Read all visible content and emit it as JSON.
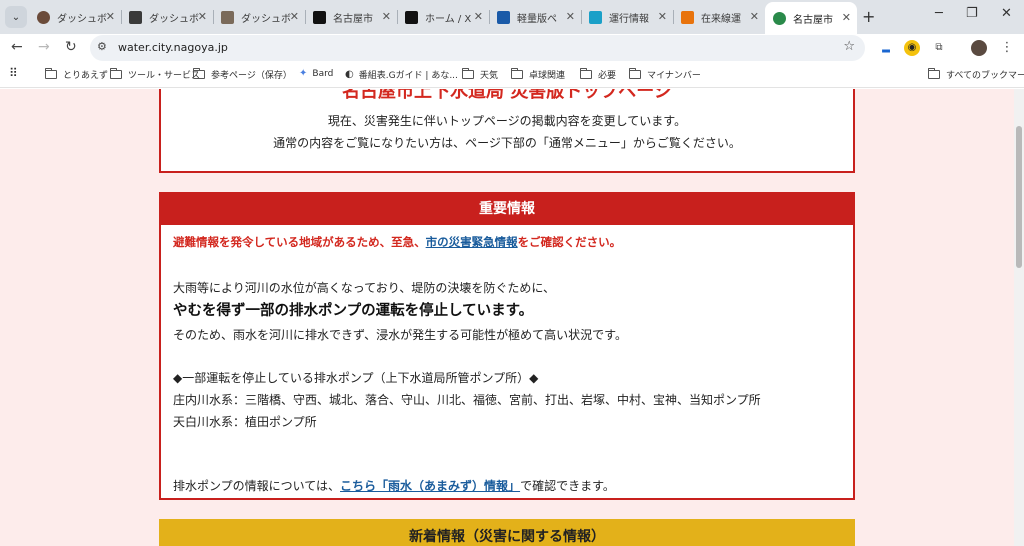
{
  "tabs": [
    {
      "label": "ダッシュボード",
      "color": "#6b4b3a"
    },
    {
      "label": "ダッシュボード",
      "color": "#3a3a3a"
    },
    {
      "label": "ダッシュボード",
      "color": "#7a6a5a"
    },
    {
      "label": "名古屋市",
      "color": "#111111"
    },
    {
      "label": "ホーム / X",
      "color": "#111111"
    },
    {
      "label": "軽量版ペ",
      "color": "#1a5aa8"
    },
    {
      "label": "運行情報",
      "color": "#1aa0c8"
    },
    {
      "label": "在来線運",
      "color": "#e8730c"
    },
    {
      "label": "名古屋市",
      "color": "#2a8a4a"
    }
  ],
  "tab_x_glyph": "✕",
  "tab_search_icon": "⌄",
  "new_tab_glyph": "+",
  "window_controls": {
    "minimize": "─",
    "restore": "❐",
    "close": "✕"
  },
  "nav": {
    "back": "←",
    "forward": "→",
    "reload": "↻"
  },
  "address": {
    "url": "water.city.nagoya.jp",
    "tune_icon": "⚙",
    "star_icon": "☆"
  },
  "extensions": [
    {
      "name": "edit-extension-icon",
      "glyph": "▂"
    },
    {
      "name": "shield-extension-icon",
      "glyph": "◉"
    },
    {
      "name": "puzzle-extension-icon",
      "glyph": "⧉"
    },
    {
      "name": "profile-avatar-icon",
      "glyph": "●"
    },
    {
      "name": "menu-icon",
      "glyph": "⋮"
    }
  ],
  "bookmarks": {
    "apps_icon": "⠿",
    "items": [
      {
        "label": "とりあえず",
        "type": "folder"
      },
      {
        "label": "ツール・サービス",
        "type": "folder"
      },
      {
        "label": "参考ページ（保存）",
        "type": "folder"
      },
      {
        "label": "Bard",
        "type": "site",
        "glyph": "✦"
      },
      {
        "label": "番組表.Gガイド | あな...",
        "type": "site",
        "glyph": "◐"
      },
      {
        "label": "天気",
        "type": "folder"
      },
      {
        "label": "卓球関連",
        "type": "folder"
      },
      {
        "label": "必要",
        "type": "folder"
      },
      {
        "label": "マイナンバー",
        "type": "folder"
      }
    ],
    "all_bookmarks": "すべてのブックマーク"
  },
  "notice": {
    "heading": "名古屋市上下水道局 災害版トップページ",
    "line1": "現在、災害発生に伴いトップページの掲載内容を変更しています。",
    "line2": "通常の内容をご覧になりたい方は、ページ下部の「通常メニュー」からご覧ください。"
  },
  "important": {
    "title": "重要情報",
    "alert_before": "避難情報を発令している地域があるため、至急、",
    "alert_link": "市の災害緊急情報",
    "alert_after": "をご確認ください。",
    "p1": "大雨等により河川の水位が高くなっており、堤防の決壊を防ぐために、",
    "p2": "やむを得ず一部の排水ポンプの運転を停止しています。",
    "p3": "そのため、雨水を河川に排水できず、浸水が発生する可能性が極めて高い状況です。",
    "pumps_heading": "◆一部運転を停止している排水ポンプ（上下水道局所管ポンプ所）◆",
    "pumps_line1": "庄内川水系：三階橋、守西、城北、落合、守山、川北、福徳、宮前、打出、岩塚、中村、宝神、当知ポンプ所",
    "pumps_line2": "天白川水系：植田ポンプ所",
    "info_before": "排水ポンプの情報については、",
    "info_link": "こちら「雨水（あまみず）情報」",
    "info_after": "で確認できます。"
  },
  "news": {
    "title": "新着情報（災害に関する情報）"
  }
}
